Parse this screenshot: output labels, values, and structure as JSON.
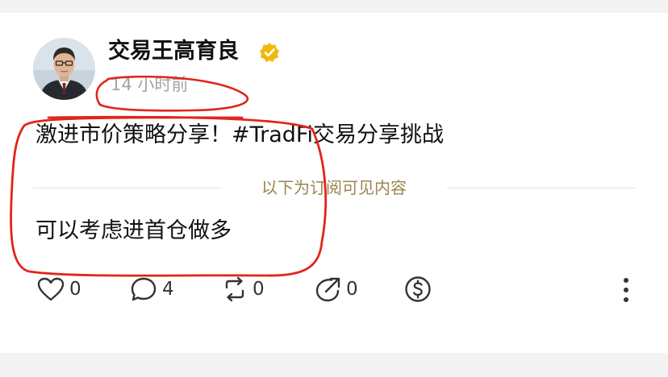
{
  "post": {
    "author": {
      "name": "交易王高育良",
      "verified": true
    },
    "time": "14 小时前",
    "text": "激进市价策略分享！#TradFi交易分享挑战",
    "subscriber_divider": "以下为订阅可见内容",
    "subscriber_text": "可以考虑进首仓做多"
  },
  "actions": {
    "like_count": "0",
    "comment_count": "4",
    "repost_count": "0",
    "share_count": "0",
    "tip_icon": "dollar-coin-icon",
    "more_icon": "more-vertical-icon"
  },
  "colors": {
    "verified_badge": "#f0b90b",
    "annotation": "#e0251b",
    "divider_text": "#9a8550",
    "muted_text": "#a3a3a3"
  }
}
